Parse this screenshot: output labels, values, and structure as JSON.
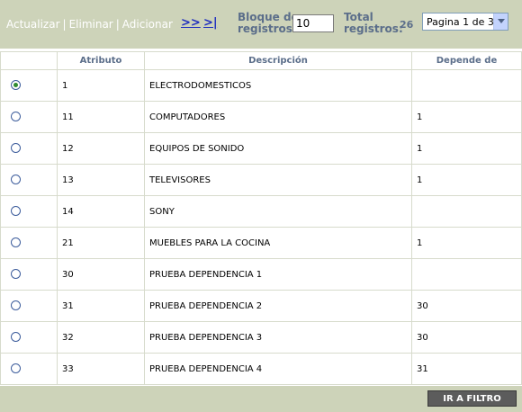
{
  "toolbar": {
    "actualizar": "Actualizar",
    "eliminar": "Eliminar",
    "adicionar": "Adicionar",
    "sep": "|",
    "next": ">>",
    "last": ">|",
    "bloque_line1": "Bloque de",
    "bloque_line2": "registros:",
    "bloque_value": "10",
    "total_line1": "Total",
    "total_line2": "registros:",
    "total_value": "26",
    "page_select": "Pagina 1 de 3"
  },
  "table": {
    "headers": [
      "",
      "Atributo",
      "Descripción",
      "Depende de"
    ],
    "rows": [
      {
        "selected": true,
        "atributo": "1",
        "descripcion": "ELECTRODOMESTICOS",
        "depende": ""
      },
      {
        "selected": false,
        "atributo": "11",
        "descripcion": "COMPUTADORES",
        "depende": "1"
      },
      {
        "selected": false,
        "atributo": "12",
        "descripcion": "EQUIPOS DE SONIDO",
        "depende": "1"
      },
      {
        "selected": false,
        "atributo": "13",
        "descripcion": "TELEVISORES",
        "depende": "1"
      },
      {
        "selected": false,
        "atributo": "14",
        "descripcion": "SONY",
        "depende": ""
      },
      {
        "selected": false,
        "atributo": "21",
        "descripcion": "MUEBLES PARA LA COCINA",
        "depende": "1"
      },
      {
        "selected": false,
        "atributo": "30",
        "descripcion": "PRUEBA DEPENDENCIA 1",
        "depende": ""
      },
      {
        "selected": false,
        "atributo": "31",
        "descripcion": "PRUEBA DEPENDENCIA 2",
        "depende": "30"
      },
      {
        "selected": false,
        "atributo": "32",
        "descripcion": "PRUEBA DEPENDENCIA 3",
        "depende": "30"
      },
      {
        "selected": false,
        "atributo": "33",
        "descripcion": "PRUEBA DEPENDENCIA 4",
        "depende": "31"
      }
    ]
  },
  "footer": {
    "filter_button": "IR A FILTRO"
  }
}
